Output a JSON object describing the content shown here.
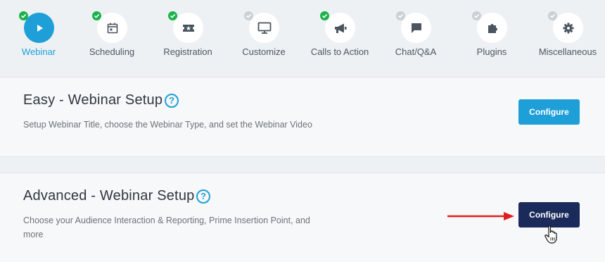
{
  "steps": [
    {
      "label": "Webinar",
      "icon": "play-icon",
      "status": "done",
      "active": true
    },
    {
      "label": "Scheduling",
      "icon": "calendar-icon",
      "status": "done",
      "active": false
    },
    {
      "label": "Registration",
      "icon": "ticket-icon",
      "status": "done",
      "active": false
    },
    {
      "label": "Customize",
      "icon": "monitor-icon",
      "status": "todo",
      "active": false
    },
    {
      "label": "Calls to Action",
      "icon": "megaphone-icon",
      "status": "done",
      "active": false
    },
    {
      "label": "Chat/Q&A",
      "icon": "chat-icon",
      "status": "todo",
      "active": false
    },
    {
      "label": "Plugins",
      "icon": "puzzle-icon",
      "status": "todo",
      "active": false
    },
    {
      "label": "Miscellaneous",
      "icon": "gear-icon",
      "status": "todo",
      "active": false
    }
  ],
  "easy": {
    "title": "Easy - Webinar Setup",
    "help": "?",
    "description": "Setup Webinar Title, choose the Webinar Type, and set the Webinar Video",
    "button": "Configure"
  },
  "advanced": {
    "title": "Advanced - Webinar Setup",
    "help": "?",
    "description": "Choose your Audience Interaction & Reporting, Prime Insertion Point, and more",
    "button": "Configure"
  },
  "colors": {
    "accent": "#1e9fd8",
    "done": "#19b34a",
    "todo": "#c9d0d6",
    "dark_button": "#1a2a5a",
    "arrow": "#e02020"
  }
}
